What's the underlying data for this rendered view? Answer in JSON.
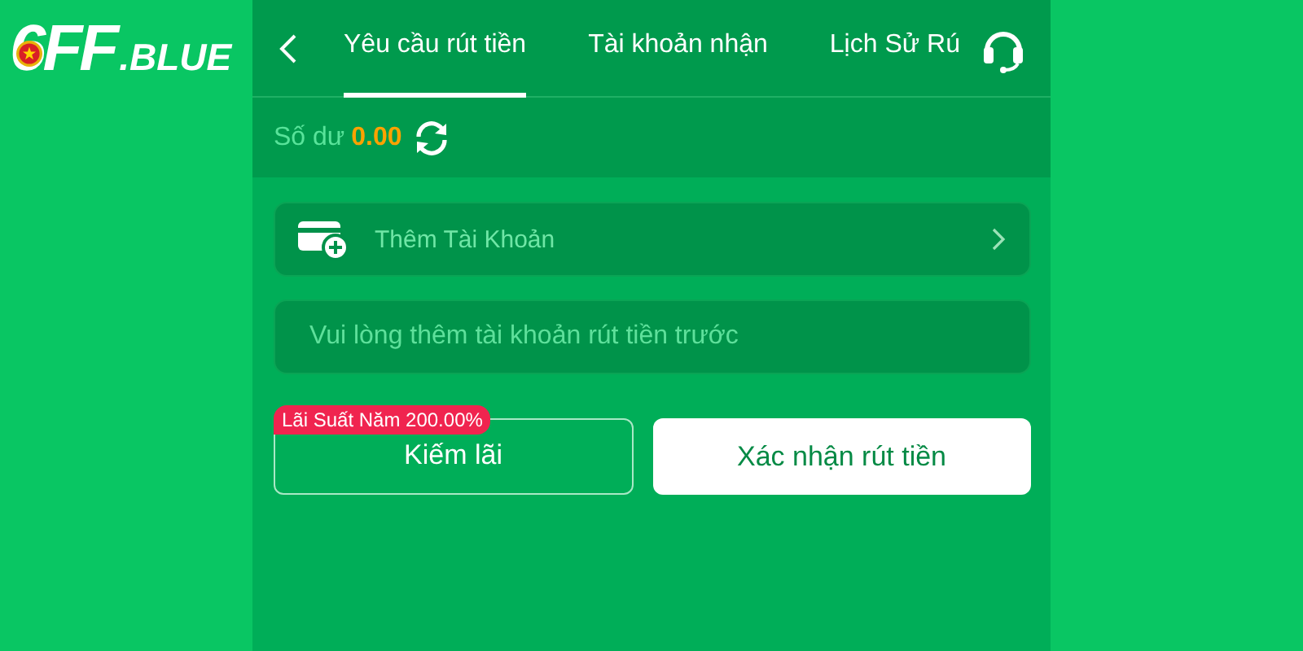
{
  "logo": {
    "number": "6FF",
    "domain": ".BLUE"
  },
  "tabs": [
    {
      "label": "Yêu cầu rút tiền",
      "selected": true
    },
    {
      "label": "Tài khoản nhận",
      "selected": false
    },
    {
      "label": "Lịch Sử Rú",
      "selected": false
    }
  ],
  "balance": {
    "label": "Số dư",
    "amount": "0.00"
  },
  "add_account": {
    "label": "Thêm Tài Khoản"
  },
  "notice": "Vui lòng thêm tài khoản rút tiền trước",
  "earn_button": {
    "label": "Kiếm lãi",
    "badge": "Lãi Suất Năm 200.00%"
  },
  "confirm_button": {
    "label": "Xác nhận rút tiền"
  }
}
